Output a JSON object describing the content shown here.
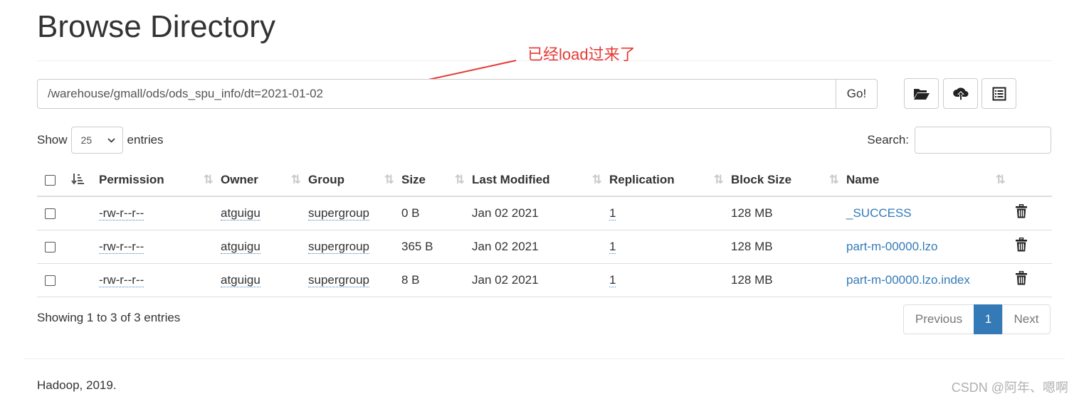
{
  "page_title": "Browse Directory",
  "annotation": "已经load过来了",
  "path_bar": {
    "value": "/warehouse/gmall/ods/ods_spu_info/dt=2021-01-02",
    "go_label": "Go!"
  },
  "toolbar": {
    "icons": [
      "folder-open-icon",
      "cloud-upload-icon",
      "list-alt-icon"
    ]
  },
  "length_control": {
    "show_label": "Show",
    "value": "25",
    "entries_label": "entries"
  },
  "search": {
    "label": "Search:",
    "value": ""
  },
  "table": {
    "columns": [
      "Permission",
      "Owner",
      "Group",
      "Size",
      "Last Modified",
      "Replication",
      "Block Size",
      "Name"
    ],
    "rows": [
      {
        "permission": "-rw-r--r--",
        "owner": "atguigu",
        "group": "supergroup",
        "size": "0 B",
        "last_modified": "Jan 02 2021",
        "replication": "1",
        "block_size": "128 MB",
        "name": "_SUCCESS"
      },
      {
        "permission": "-rw-r--r--",
        "owner": "atguigu",
        "group": "supergroup",
        "size": "365 B",
        "last_modified": "Jan 02 2021",
        "replication": "1",
        "block_size": "128 MB",
        "name": "part-m-00000.lzo"
      },
      {
        "permission": "-rw-r--r--",
        "owner": "atguigu",
        "group": "supergroup",
        "size": "8 B",
        "last_modified": "Jan 02 2021",
        "replication": "1",
        "block_size": "128 MB",
        "name": "part-m-00000.lzo.index"
      }
    ]
  },
  "info_text": "Showing 1 to 3 of 3 entries",
  "pagination": {
    "previous": "Previous",
    "current": "1",
    "next": "Next"
  },
  "footer": "Hadoop, 2019.",
  "watermark": "CSDN @阿年、嗯啊",
  "colors": {
    "link": "#337ab7",
    "annotation": "#e53935",
    "active_page": "#337ab7"
  }
}
